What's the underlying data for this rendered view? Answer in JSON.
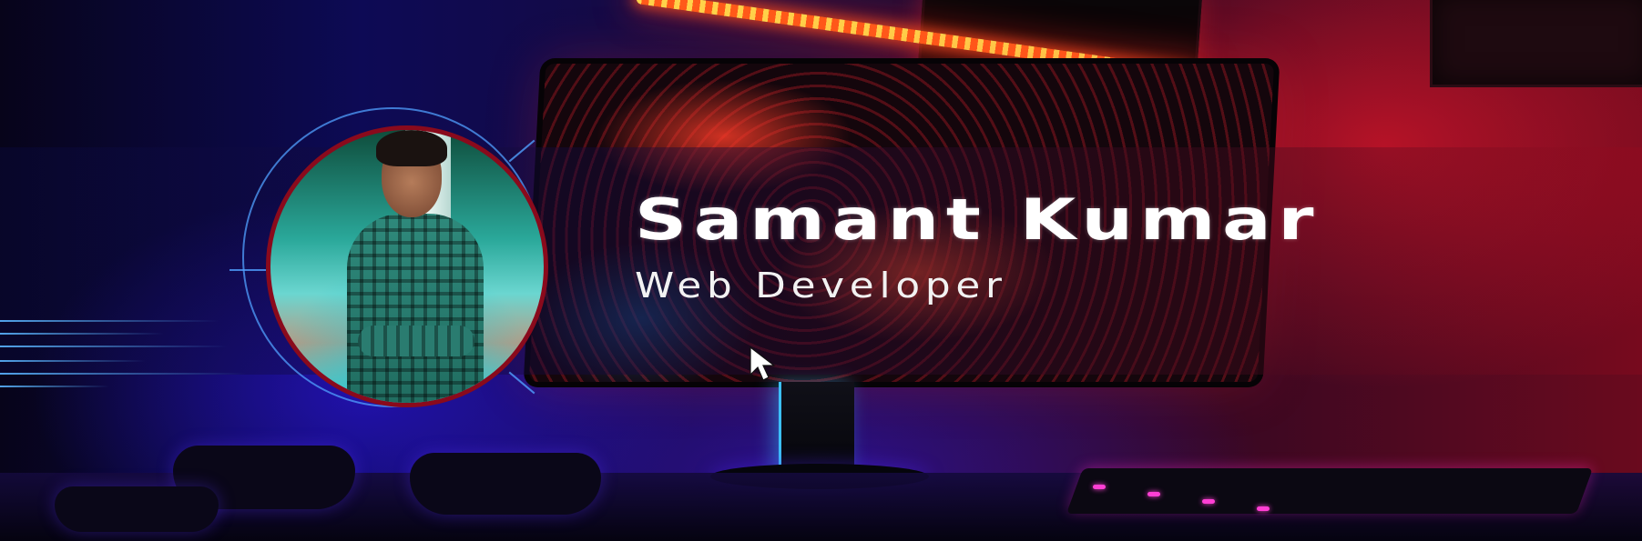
{
  "profile": {
    "name": "Samant Kumar",
    "role": "Web Developer"
  },
  "icons": {
    "cursor": "mouse-pointer-icon"
  },
  "colors": {
    "text": "#ffffff",
    "avatar_border": "#8a0a1c",
    "ring_accent": "#50a0ff",
    "glow_red": "#c81428",
    "glow_blue": "#2814c8"
  }
}
